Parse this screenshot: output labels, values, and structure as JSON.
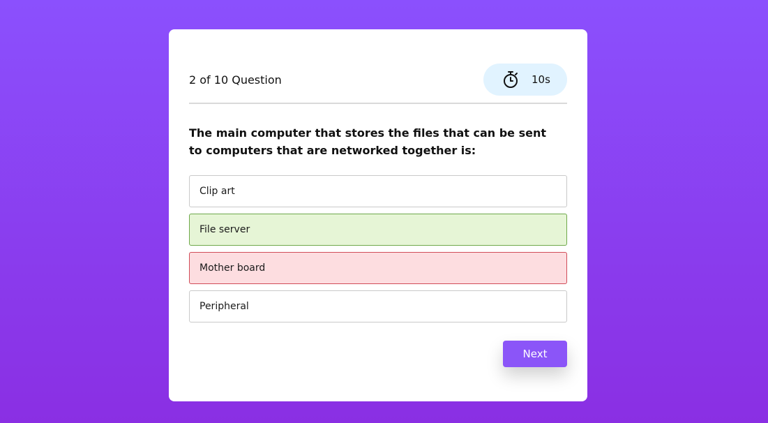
{
  "quiz": {
    "counter_text": "2 of 10 Question",
    "timer": {
      "icon": "stopwatch-icon",
      "value": "10s"
    },
    "question": "The main computer that stores the files that can be sent to computers that are networked together is:",
    "options": [
      {
        "label": "Clip art",
        "state": "neutral"
      },
      {
        "label": "File server",
        "state": "correct"
      },
      {
        "label": "Mother board",
        "state": "wrong"
      },
      {
        "label": "Peripheral",
        "state": "neutral"
      }
    ],
    "next_label": "Next"
  },
  "colors": {
    "background_top": "#8b50fd",
    "background_bottom": "#8a2fe3",
    "timer_bg": "#e1f3ff",
    "correct_bg": "#e6f5d6",
    "correct_border": "#6ea84a",
    "wrong_bg": "#fddde0",
    "wrong_border": "#d04c58",
    "button": "#8b55f8"
  }
}
